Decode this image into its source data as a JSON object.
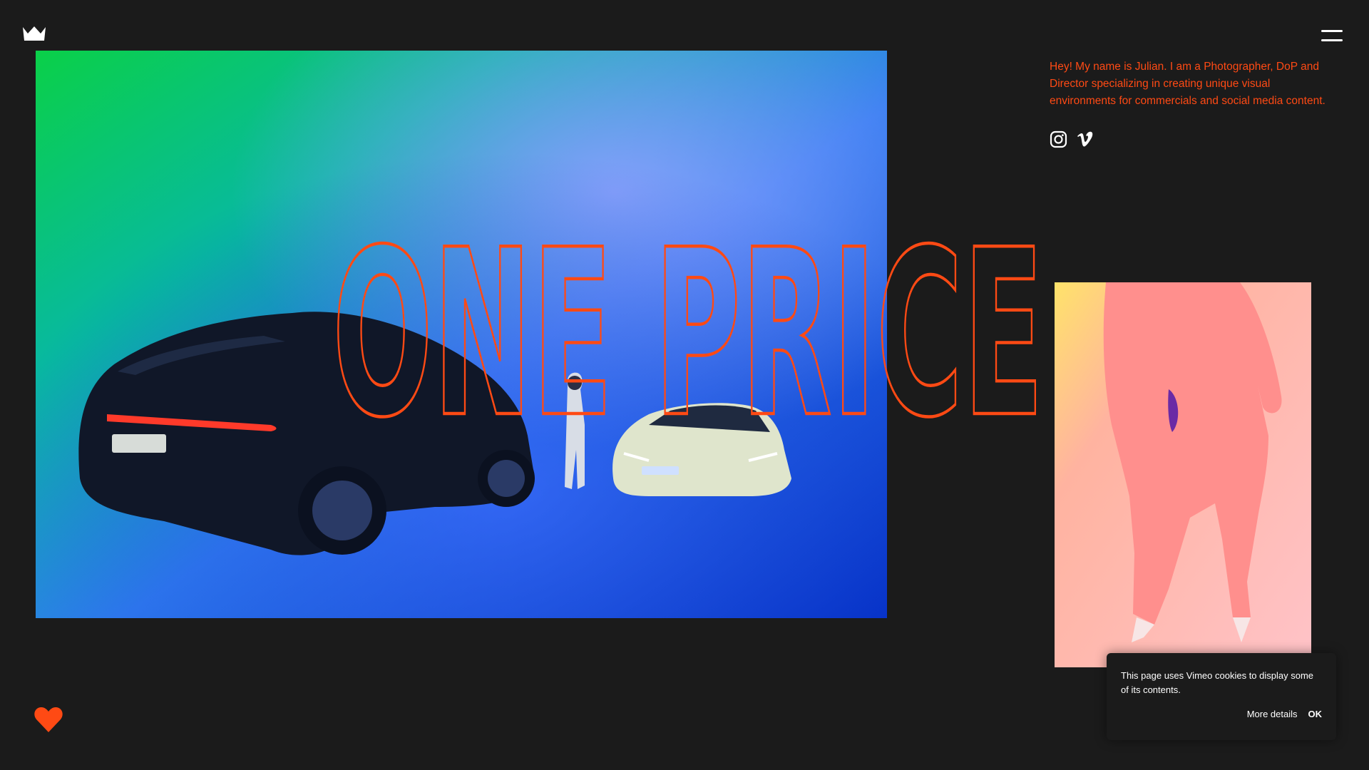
{
  "brand": {
    "logo_icon": "crown-icon",
    "accent_color": "#ff4a14",
    "background_color": "#1b1b1b"
  },
  "header": {
    "menu_icon": "hamburger-menu-icon"
  },
  "intro": {
    "text": "Hey! My name is Julian. I am a Photographer, DoP and Director specializing in creating unique visual environments for commercials and social media content.",
    "socials": [
      {
        "icon": "instagram-icon"
      },
      {
        "icon": "vimeo-icon"
      }
    ]
  },
  "headline": {
    "text": "ONE PRICE"
  },
  "gallery": {
    "hero_image": "car-photo",
    "side_image": "fashion-photo"
  },
  "footer": {
    "like_icon": "heart-icon"
  },
  "cookie_notice": {
    "message": "This page uses Vimeo cookies to display some of its contents.",
    "more_label": "More details",
    "ok_label": "OK"
  }
}
